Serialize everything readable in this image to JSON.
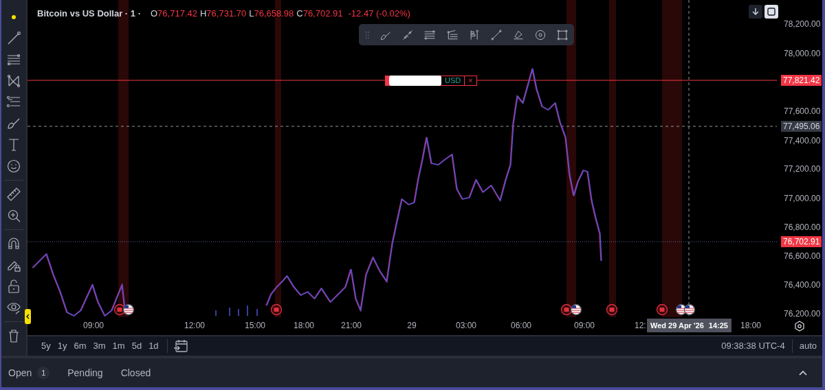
{
  "legend": {
    "symbol": "Bitcoin vs US Dollar · 1 ·",
    "ohlc": [
      {
        "key": "O",
        "value": "76,717.42"
      },
      {
        "key": "H",
        "value": "76,731.70"
      },
      {
        "key": "L",
        "value": "76,658.98"
      },
      {
        "key": "C",
        "value": "76,702.91"
      }
    ],
    "change": "-12.47 (-0.02%)"
  },
  "order_line": {
    "currency": "USD",
    "close": "×",
    "price": "77,821.42"
  },
  "crosshair": {
    "price": "77,495.06",
    "date": "Wed 29 Apr '26",
    "time": "14:25"
  },
  "last_price": "76,702.91",
  "price_axis": [
    "78,200.00",
    "78,000.00",
    "77,600.00",
    "77,400.00",
    "77,200.00",
    "77,000.00",
    "76,800.00",
    "76,600.00",
    "76,400.00",
    "76,200.00"
  ],
  "time_axis": [
    "09:00",
    "12:00",
    "15:00",
    "18:00",
    "21:00",
    "29",
    "03:00",
    "06:00",
    "09:00",
    "12:",
    "18:00"
  ],
  "ranges": [
    "5y",
    "1y",
    "6m",
    "3m",
    "1m",
    "5d",
    "1d"
  ],
  "clock": "09:38:38 UTC-4",
  "scale_mode": "auto",
  "trade_tabs": [
    {
      "label": "Open",
      "count": "1"
    },
    {
      "label": "Pending"
    },
    {
      "label": "Closed"
    }
  ]
}
